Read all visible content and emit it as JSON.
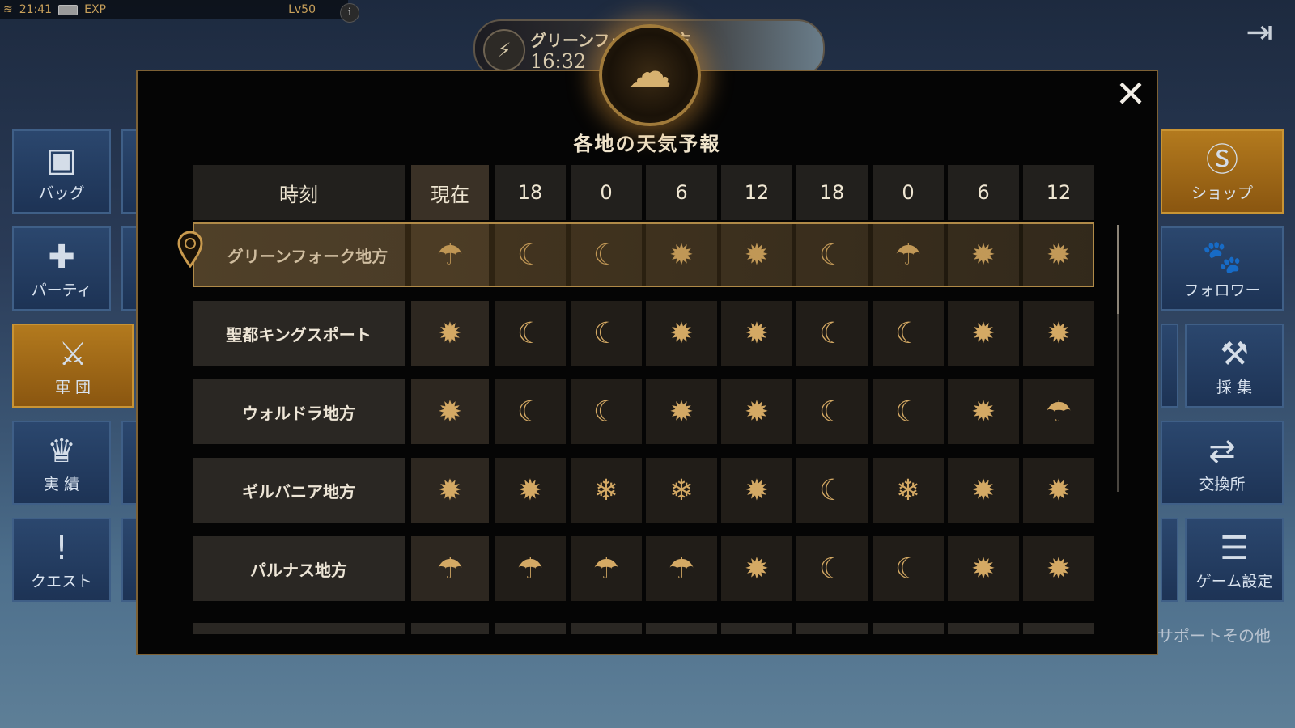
{
  "status_bar": {
    "time": "21:41",
    "exp_label": "EXP",
    "level": "Lv50"
  },
  "info_icon_glyph": "i",
  "weather_pill": {
    "region": "グリーンフォーク地方",
    "time": "16:32",
    "icon": "storm-icon"
  },
  "left_menu": [
    {
      "label": "バッグ",
      "icon": "bag-icon",
      "glyph": "▣"
    },
    {
      "label": "パーティ",
      "icon": "party-icon",
      "glyph": "✚"
    },
    {
      "label": "軍 団",
      "icon": "legion-icon",
      "glyph": "⚔"
    },
    {
      "label": "実 績",
      "icon": "achievement-icon",
      "glyph": "♛"
    },
    {
      "label": "クエスト",
      "icon": "quest-icon",
      "glyph": "!"
    }
  ],
  "right_menu": [
    {
      "label": "ショップ",
      "icon": "shop-icon",
      "glyph": "Ⓢ"
    },
    {
      "label": "フォロワー",
      "icon": "follower-icon",
      "glyph": "🐾"
    },
    {
      "label": "採 集",
      "icon": "gather-icon",
      "glyph": "⚒"
    },
    {
      "label": "交換所",
      "icon": "exchange-icon",
      "glyph": "⇄"
    },
    {
      "label": "ゲーム設定",
      "icon": "settings-icon",
      "glyph": "☰"
    }
  ],
  "support_label": "サポートその他",
  "modal": {
    "title": "各地の天気予報",
    "close_glyph": "✕",
    "time_header_label": "時刻",
    "time_columns": [
      "現在",
      "18",
      "0",
      "6",
      "12",
      "18",
      "0",
      "6",
      "12"
    ],
    "current_region_index": 0,
    "rows": [
      {
        "region": "グリーンフォーク地方",
        "weather": [
          "rain",
          "moon",
          "moon",
          "sun",
          "sun",
          "moon",
          "rain",
          "sun",
          "sun"
        ]
      },
      {
        "region": "聖都キングスポート",
        "weather": [
          "sun",
          "moon",
          "moon",
          "sun",
          "sun",
          "moon",
          "moon",
          "sun",
          "sun"
        ]
      },
      {
        "region": "ウォルドラ地方",
        "weather": [
          "sun",
          "moon",
          "moon",
          "sun",
          "sun",
          "moon",
          "moon",
          "sun",
          "rain"
        ]
      },
      {
        "region": "ギルバニア地方",
        "weather": [
          "sun",
          "sun",
          "snow",
          "snow",
          "sun",
          "moon",
          "snow",
          "sun",
          "sun"
        ]
      },
      {
        "region": "パルナス地方",
        "weather": [
          "rain",
          "rain",
          "rain",
          "rain",
          "sun",
          "moon",
          "moon",
          "sun",
          "sun"
        ]
      }
    ]
  },
  "weather_glyphs": {
    "sun": "✹",
    "moon": "☾",
    "rain": "☂",
    "snow": "❄"
  },
  "colors": {
    "accent_gold": "#b08a48",
    "icon_gold": "#d4a964",
    "panel_bg": "#050505",
    "button_blue": "#2b476e",
    "button_orange": "#b37a1e"
  }
}
